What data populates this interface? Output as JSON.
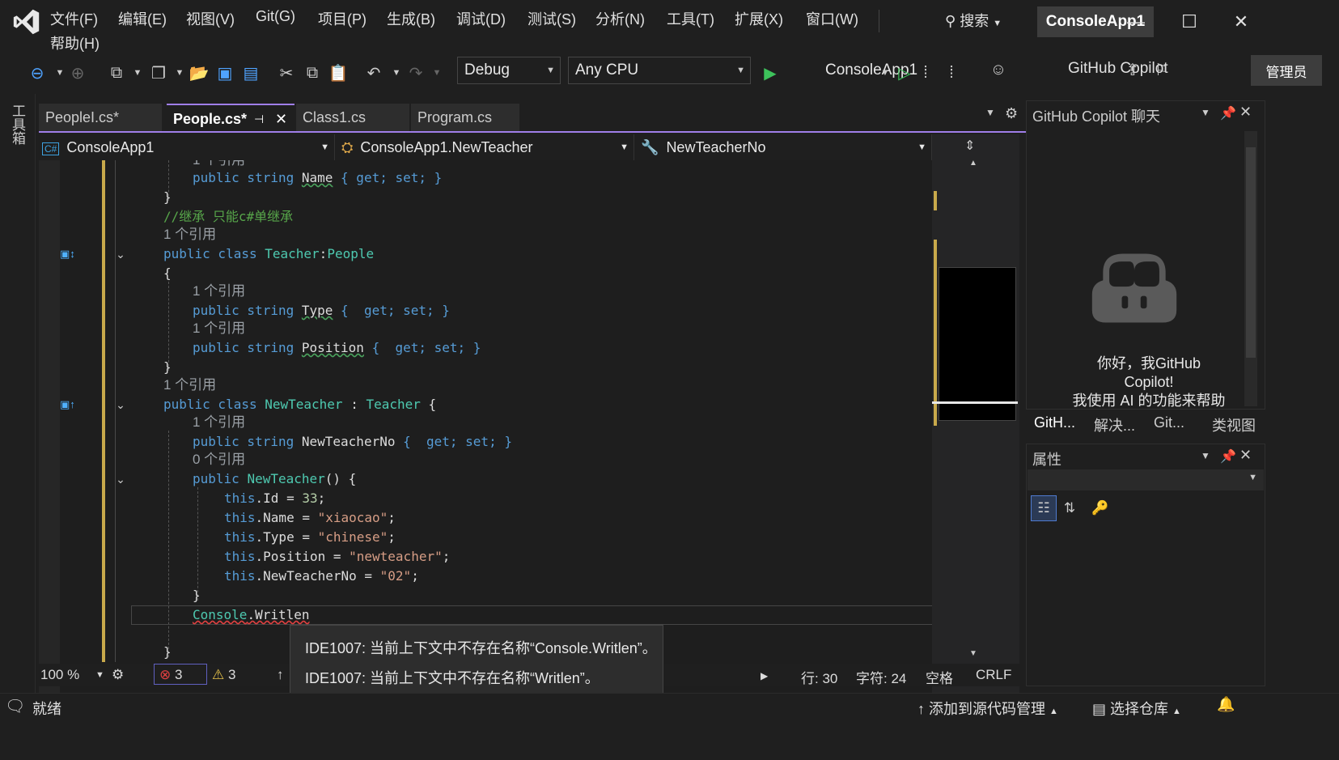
{
  "menu": {
    "file": "文件(F)",
    "edit": "编辑(E)",
    "view": "视图(V)",
    "git": "Git(G)",
    "project": "项目(P)",
    "build": "生成(B)",
    "debug": "调试(D)",
    "test": "测试(S)",
    "analyze": "分析(N)",
    "tools": "工具(T)",
    "extensions": "扩展(X)",
    "window": "窗口(W)",
    "help": "帮助(H)"
  },
  "search_label": "搜索",
  "solution_name": "ConsoleApp1",
  "toolbar": {
    "config": "Debug",
    "platform": "Any CPU",
    "run_target": "ConsoleApp1",
    "copilot": "GitHub Copilot",
    "admin": "管理员"
  },
  "toolbox_label": "工具箱",
  "tabs": [
    {
      "label": "PeopleI.cs*"
    },
    {
      "label": "People.cs*"
    },
    {
      "label": "Class1.cs"
    },
    {
      "label": "Program.cs"
    }
  ],
  "navbar": {
    "project": "ConsoleApp1",
    "type": "ConsoleApp1.NewTeacher",
    "member": "NewTeacherNo"
  },
  "code": {
    "refs1": "1 个引用",
    "name_line": {
      "kw": "public string",
      "name": "Name",
      "rest": " { get; set; }"
    },
    "comment": "//继承 只能c#单继承",
    "refs_teacher": "1 个引用",
    "teacher_decl": {
      "kw": "public class",
      "name": "Teacher",
      "base": "People"
    },
    "refs_type": "1 个引用",
    "type_line": {
      "kw": "public string",
      "name": "Type",
      "rest": " {  get; set; }"
    },
    "refs_position": "1 个引用",
    "position_line": {
      "kw": "public string",
      "name": "Position",
      "rest": " {  get; set; }"
    },
    "refs_newteacher": "1 个引用",
    "newteacher_decl": {
      "kw": "public class",
      "name": "NewTeacher",
      "base": "Teacher"
    },
    "refs_no": "1 个引用",
    "no_line": {
      "kw": "public string",
      "name": "NewTeacherNo",
      "rest": " {  get; set; }"
    },
    "refs_ctor": "0 个引用",
    "ctor_line": {
      "kw": "public",
      "name": "NewTeacher",
      "rest": "() {"
    },
    "assign_id": {
      "kw": "this",
      "rest": ".Id = ",
      "val": "33",
      "end": ";"
    },
    "assign_name": {
      "kw": "this",
      "rest": ".Name = ",
      "val": "\"xiaocao\"",
      "end": ";"
    },
    "assign_type": {
      "kw": "this",
      "rest": ".Type = ",
      "val": "\"chinese\"",
      "end": ";"
    },
    "assign_position": {
      "kw": "this",
      "rest": ".Position = ",
      "val": "\"newteacher\"",
      "end": ";"
    },
    "assign_no": {
      "kw": "this",
      "rest": ".NewTeacherNo = ",
      "val": "\"02\"",
      "end": ";"
    },
    "error_line": {
      "ty": "Console",
      "rest": ".Writlen"
    }
  },
  "tooltip": {
    "line1": "IDE1007: 当前上下文中不存在名称“Console.Writlen”。",
    "line2": "IDE1007: 当前上下文中不存在名称“Writlen”。"
  },
  "editor_status": {
    "zoom": "100 %",
    "errors": "3",
    "warnings": "3",
    "line": "行: 30",
    "char": "字符: 24",
    "indent": "空格",
    "eol": "CRLF"
  },
  "copilot_panel": {
    "title": "GitHub Copilot 聊天",
    "greet1": "你好，我GitHub",
    "greet2": "Copilot!",
    "greet3": "我使用 AI 的功能来帮助"
  },
  "panel_tabs": [
    "GitH...",
    "解决...",
    "Git...",
    "类视图"
  ],
  "props_title": "属性",
  "status": {
    "ready": "就绪",
    "source_control": "添加到源代码管理",
    "repo": "选择仓库"
  },
  "colors": {
    "accent": "#9f7ee8",
    "keyword": "#569cd6",
    "type": "#4ec9b0",
    "string": "#d69d85",
    "comment": "#57a64a"
  }
}
